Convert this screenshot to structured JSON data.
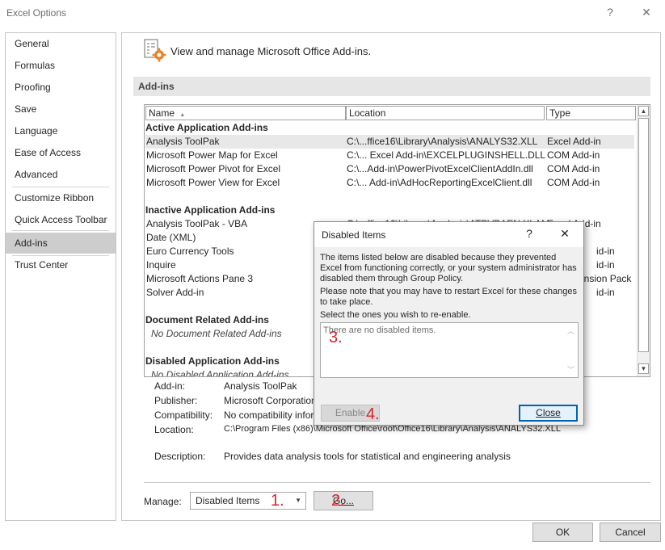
{
  "window": {
    "title": "Excel Options",
    "help": "?",
    "close": "✕"
  },
  "sidebar": {
    "items": [
      {
        "label": "General"
      },
      {
        "label": "Formulas"
      },
      {
        "label": "Proofing"
      },
      {
        "label": "Save"
      },
      {
        "label": "Language"
      },
      {
        "label": "Ease of Access"
      },
      {
        "label": "Advanced"
      },
      {
        "label": "Customize Ribbon"
      },
      {
        "label": "Quick Access Toolbar"
      },
      {
        "label": "Add-ins",
        "selected": true
      },
      {
        "label": "Trust Center"
      }
    ]
  },
  "main": {
    "heading": "View and manage Microsoft Office Add-ins.",
    "section_title": "Add-ins",
    "columns": {
      "name": "Name",
      "sort_indicator": "▲",
      "location": "Location",
      "type": "Type"
    },
    "groups": {
      "active": {
        "title": "Active Application Add-ins",
        "rows": [
          {
            "name": "Analysis ToolPak",
            "location": "C:\\...ffice16\\Library\\Analysis\\ANALYS32.XLL",
            "type": "Excel Add-in"
          },
          {
            "name": "Microsoft Power Map for Excel",
            "location": "C:\\... Excel Add-in\\EXCELPLUGINSHELL.DLL",
            "type": "COM Add-in"
          },
          {
            "name": "Microsoft Power Pivot for Excel",
            "location": "C:\\...Add-in\\PowerPivotExcelClientAddIn.dll",
            "type": "COM Add-in"
          },
          {
            "name": "Microsoft Power View for Excel",
            "location": "C:\\... Add-in\\AdHocReportingExcelClient.dll",
            "type": "COM Add-in"
          }
        ]
      },
      "inactive": {
        "title": "Inactive Application Add-ins",
        "rows": [
          {
            "name": "Analysis ToolPak - VBA",
            "location": "C:\\...ffice16\\Library\\Analysis\\ATPVBAEN.XLAM",
            "type": "Excel Add-in"
          },
          {
            "name": "Date (XML)",
            "location": "",
            "type": ""
          },
          {
            "name": "Euro Currency Tools",
            "location": "",
            "type": "id-in"
          },
          {
            "name": "Inquire",
            "location": "",
            "type": "id-in"
          },
          {
            "name": "Microsoft Actions Pane 3",
            "location": "",
            "type": "ansion Pack"
          },
          {
            "name": "Solver Add-in",
            "location": "",
            "type": "id-in"
          }
        ]
      },
      "document": {
        "title": "Document Related Add-ins",
        "empty": "No Document Related Add-ins"
      },
      "disabled": {
        "title": "Disabled Application Add-ins",
        "empty": "No Disabled Application Add-ins"
      }
    },
    "details": {
      "addin_label": "Add-in:",
      "addin_value": "Analysis ToolPak",
      "publisher_label": "Publisher:",
      "publisher_value": "Microsoft Corporation",
      "compat_label": "Compatibility:",
      "compat_value": "No compatibility information available",
      "location_label": "Location:",
      "location_value": "C:\\Program Files (x86)\\Microsoft Office\\root\\Office16\\Library\\Analysis\\ANALYS32.XLL",
      "description_label": "Description:",
      "description_value": "Provides data analysis tools for statistical and engineering analysis"
    },
    "manage": {
      "label": "Manage:",
      "selected": "Disabled Items",
      "go_label": "Go...",
      "annotation_1": "1.",
      "annotation_2": "2."
    }
  },
  "footer": {
    "ok_label": "OK",
    "cancel_label": "Cancel"
  },
  "dialog": {
    "title": "Disabled Items",
    "help": "?",
    "close": "✕",
    "text1": "The items listed below are disabled because they prevented Excel from functioning correctly, or your system administrator has disabled them through Group Policy.",
    "text2": "Please note that you may have to restart Excel for these changes to take place.",
    "text3": "Select the ones you wish to re-enable.",
    "list_empty": "There are no disabled items.",
    "enable_label": "Enable",
    "close_label": "Close",
    "annotation_3": "3.",
    "annotation_4": "4."
  },
  "colors": {
    "annotation": "#d9262c",
    "selected_nav": "#cdcdcd",
    "accent_border": "#0063b1"
  }
}
